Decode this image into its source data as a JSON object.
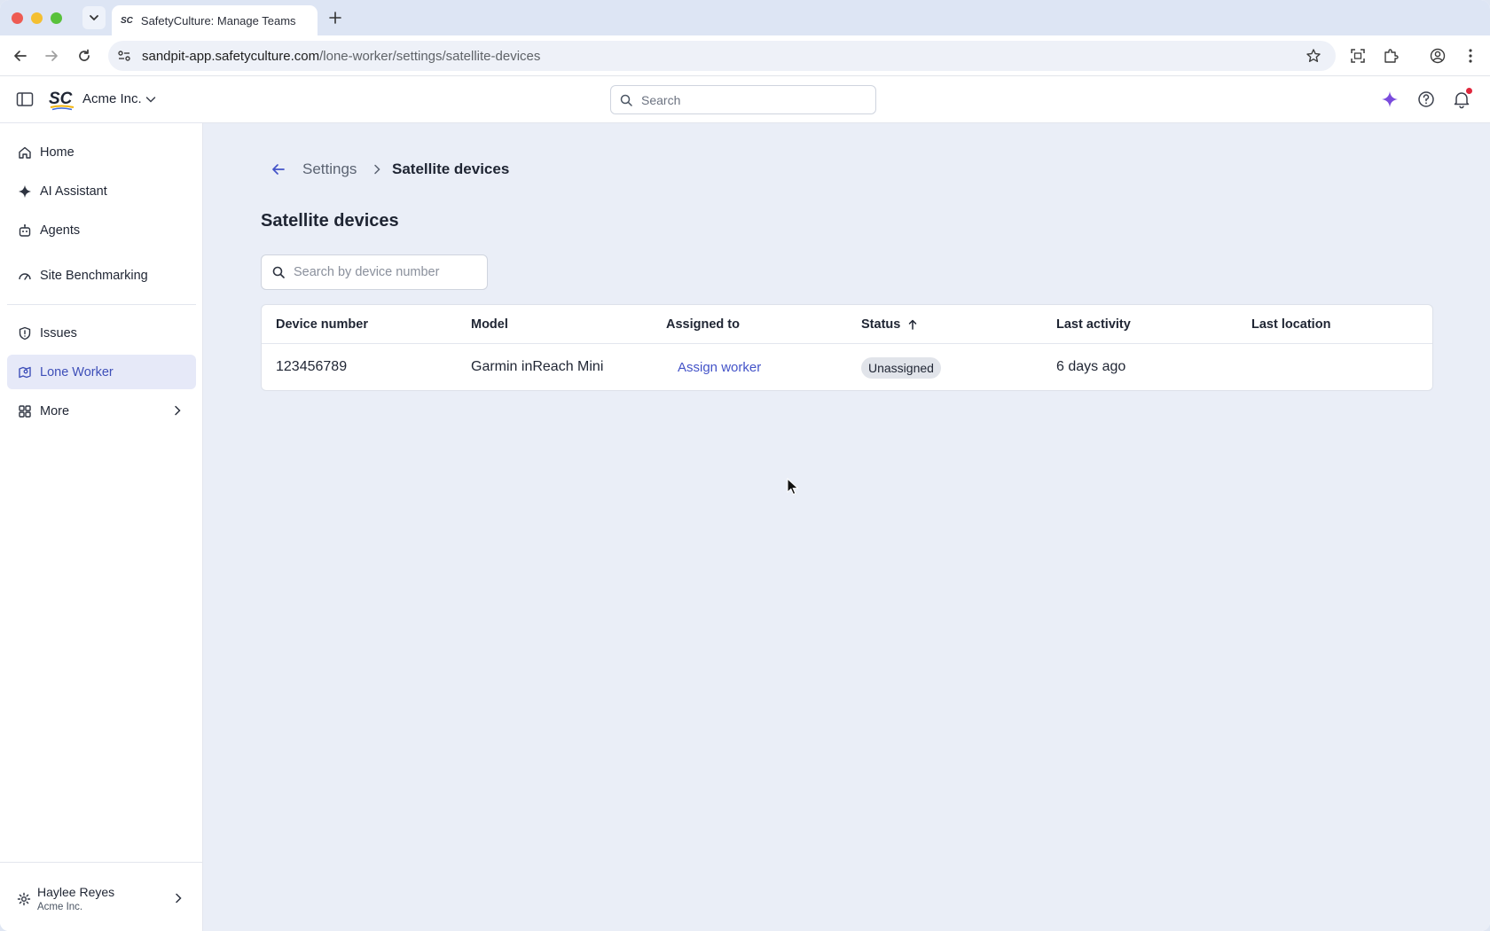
{
  "browser": {
    "tab_title": "SafetyCulture: Manage Teams",
    "tab_favicon": "SC",
    "url_host": "sandpit-app.safetyculture.com",
    "url_path": "/lone-worker/settings/satellite-devices"
  },
  "header": {
    "org_name": "Acme Inc.",
    "search_placeholder": "Search"
  },
  "sidebar": {
    "items": [
      {
        "label": "Home",
        "icon": "home-icon"
      },
      {
        "label": "AI Assistant",
        "icon": "sparkle-icon"
      },
      {
        "label": "Agents",
        "icon": "robot-icon"
      },
      {
        "label": "Site Benchmarking",
        "icon": "gauge-icon"
      },
      {
        "label": "Issues",
        "icon": "shield-alert-icon"
      },
      {
        "label": "Lone Worker",
        "icon": "map-pin-icon",
        "active": true
      },
      {
        "label": "More",
        "icon": "grid-icon"
      }
    ],
    "user": {
      "name": "Haylee Reyes",
      "org": "Acme Inc."
    }
  },
  "main": {
    "breadcrumb": {
      "parent": "Settings",
      "current": "Satellite devices"
    },
    "title": "Satellite devices",
    "search_placeholder": "Search by device number",
    "table": {
      "columns": [
        "Device number",
        "Model",
        "Assigned to",
        "Status",
        "Last activity",
        "Last location"
      ],
      "rows": [
        {
          "device_number": "123456789",
          "model": "Garmin inReach Mini",
          "assigned_to": "Assign worker",
          "status": "Unassigned",
          "last_activity": "6 days ago",
          "last_location": ""
        }
      ]
    }
  },
  "colors": {
    "accent": "#4353c8",
    "active_nav_bg": "#e6e9f8",
    "main_bg": "#eaeef7",
    "notification_dot": "#e0273d"
  }
}
